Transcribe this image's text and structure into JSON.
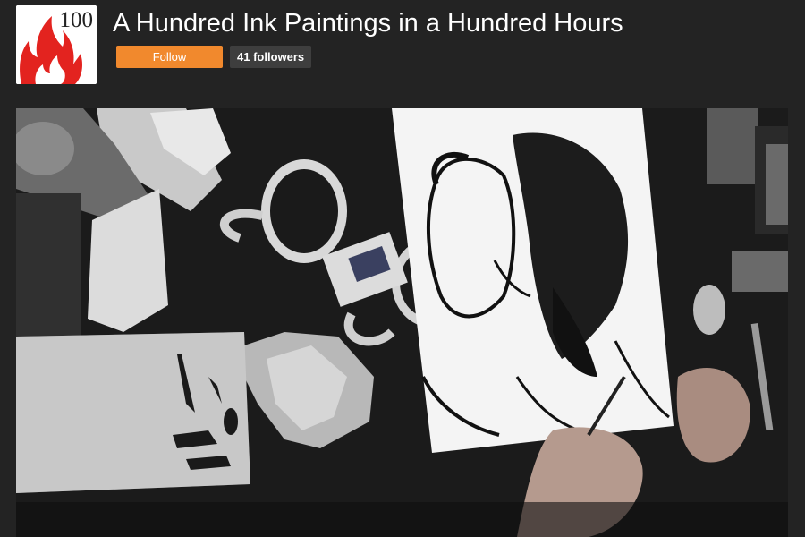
{
  "header": {
    "logo": {
      "number_text": "100",
      "icon": "flame-icon",
      "flame_color": "#e3231f"
    },
    "title": "A Hundred Ink Paintings in a Hundred Hours",
    "follow_label": "Follow",
    "followers_label": "41 followers"
  },
  "colors": {
    "background": "#232323",
    "accent": "#f1892d",
    "badge": "#3e3e3e"
  },
  "video": {
    "content": "live-stream-video-frame"
  }
}
